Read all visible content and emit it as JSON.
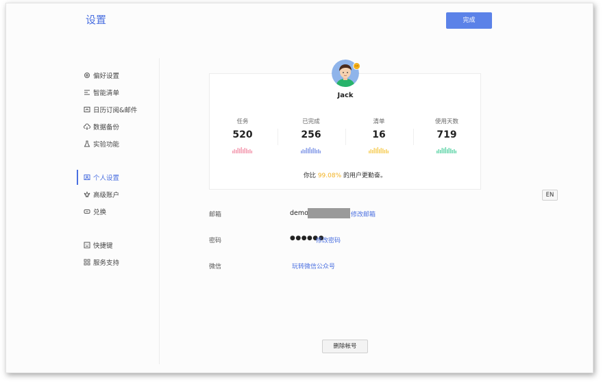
{
  "header": {
    "title": "设置",
    "done_label": "完成"
  },
  "sidebar": {
    "groups": [
      [
        {
          "label": "偏好设置",
          "icon": "gear-icon"
        },
        {
          "label": "智能清单",
          "icon": "smart-list-icon"
        },
        {
          "label": "日历订阅&邮件",
          "icon": "calendar-icon"
        },
        {
          "label": "数据备份",
          "icon": "cloud-backup-icon"
        },
        {
          "label": "实验功能",
          "icon": "flask-icon"
        }
      ],
      [
        {
          "label": "个人设置",
          "icon": "profile-icon",
          "active": true
        },
        {
          "label": "高级账户",
          "icon": "crown-icon"
        },
        {
          "label": "兑换",
          "icon": "ticket-icon"
        }
      ],
      [
        {
          "label": "快捷键",
          "icon": "keyboard-icon"
        },
        {
          "label": "服务支持",
          "icon": "grid-icon"
        }
      ]
    ]
  },
  "profile": {
    "name": "Jack",
    "stats": [
      {
        "label": "任务",
        "value": "520",
        "color": "#f4a0b4"
      },
      {
        "label": "已完成",
        "value": "256",
        "color": "#8fa3ea"
      },
      {
        "label": "清单",
        "value": "16",
        "color": "#f7d36a"
      },
      {
        "label": "使用天数",
        "value": "719",
        "color": "#6fd8b0"
      }
    ],
    "compare_prefix": "你比",
    "compare_pct": "99.08%",
    "compare_suffix": "的用户更勤奋。"
  },
  "account": {
    "email_label": "邮箱",
    "email_value": "demo",
    "email_link": "修改邮箱",
    "password_label": "密码",
    "password_dots": "●●●●●●",
    "password_link": "修改密码",
    "wechat_label": "微信",
    "wechat_link": "玩转微信公众号"
  },
  "lang_button": "EN",
  "delete_label": "删除帐号",
  "colors": {
    "accent": "#4a6fe0",
    "primary_button": "#5b82e8",
    "highlight": "#f2b11f"
  }
}
